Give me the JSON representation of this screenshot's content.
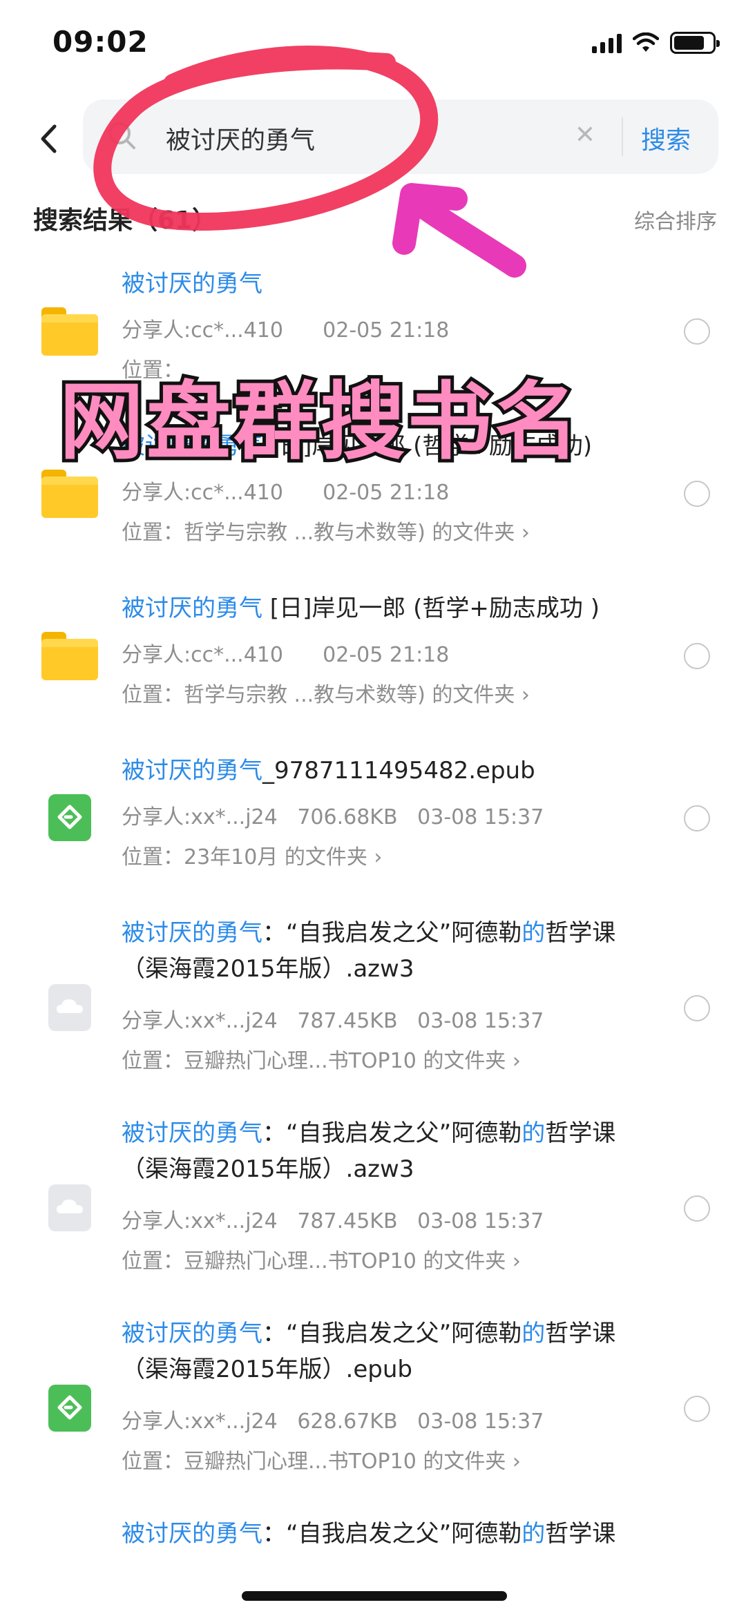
{
  "status_bar": {
    "time": "09:02"
  },
  "search": {
    "query": "被讨厌的勇气",
    "clear_symbol": "✕",
    "submit_label": "搜索"
  },
  "results": {
    "title": "搜索结果（61）",
    "sort_label": "综合排序",
    "items": [
      {
        "icon": "folder-icon",
        "title_hl": "被讨厌的勇气",
        "title_rest": "",
        "line2": "",
        "meta": "分享人:cc*...410      02-05 21:18",
        "location": "位置："
      },
      {
        "icon": "folder-icon",
        "title_hl": "被讨厌的勇气",
        "title_rest": " [日]岸见一郎 (哲学+励志成功)",
        "line2": "",
        "meta": "分享人:cc*...410      02-05 21:18",
        "location": "位置：哲学与宗教 ...教与术数等) 的文件夹 ›"
      },
      {
        "icon": "folder-icon",
        "title_hl": "被讨厌的勇气",
        "title_rest": " [日]岸见一郎 (哲学+励志成功 )",
        "line2": "",
        "meta": "分享人:cc*...410      02-05 21:18",
        "location": "位置：哲学与宗教 ...教与术数等) 的文件夹 ›"
      },
      {
        "icon": "epub-icon",
        "title_hl": "被讨厌的勇气",
        "title_rest": "_9787111495482.epub",
        "line2": "",
        "meta": "分享人:xx*...j24   706.68KB   03-08 15:37",
        "location": "位置：23年10月 的文件夹 ›"
      },
      {
        "icon": "cloud-icon",
        "title_hl": "被讨厌的勇气",
        "title_rest": "：“自我启发之父”阿德勒",
        "title_hl2": "的",
        "title_rest2": "哲学课",
        "line2": "（渠海霞2015年版）.azw3",
        "meta": "分享人:xx*...j24   787.45KB   03-08 15:37",
        "location": "位置：豆瓣热门心理...书TOP10 的文件夹 ›"
      },
      {
        "icon": "cloud-icon",
        "title_hl": "被讨厌的勇气",
        "title_rest": "：“自我启发之父”阿德勒",
        "title_hl2": "的",
        "title_rest2": "哲学课",
        "line2": "（渠海霞2015年版）.azw3",
        "meta": "分享人:xx*...j24   787.45KB   03-08 15:37",
        "location": "位置：豆瓣热门心理...书TOP10 的文件夹 ›"
      },
      {
        "icon": "epub-icon",
        "title_hl": "被讨厌的勇气",
        "title_rest": "：“自我启发之父”阿德勒",
        "title_hl2": "的",
        "title_rest2": "哲学课",
        "line2": "（渠海霞2015年版）.epub",
        "meta": "分享人:xx*...j24   628.67KB   03-08 15:37",
        "location": "位置：豆瓣热门心理...书TOP10 的文件夹 ›"
      },
      {
        "icon": "epub-icon",
        "title_hl": "被讨厌的勇气",
        "title_rest": "：“自我启发之父”阿德勒",
        "title_hl2": "的",
        "title_rest2": "哲学课",
        "line2": "",
        "meta": "",
        "location": ""
      }
    ]
  },
  "overlay": {
    "caption": "网盘群搜书名",
    "circle_color": "#f0365c",
    "arrow_color": "#e83ab8",
    "caption_color": "#ff8cc0"
  },
  "colors": {
    "accent": "#2c8be8"
  }
}
